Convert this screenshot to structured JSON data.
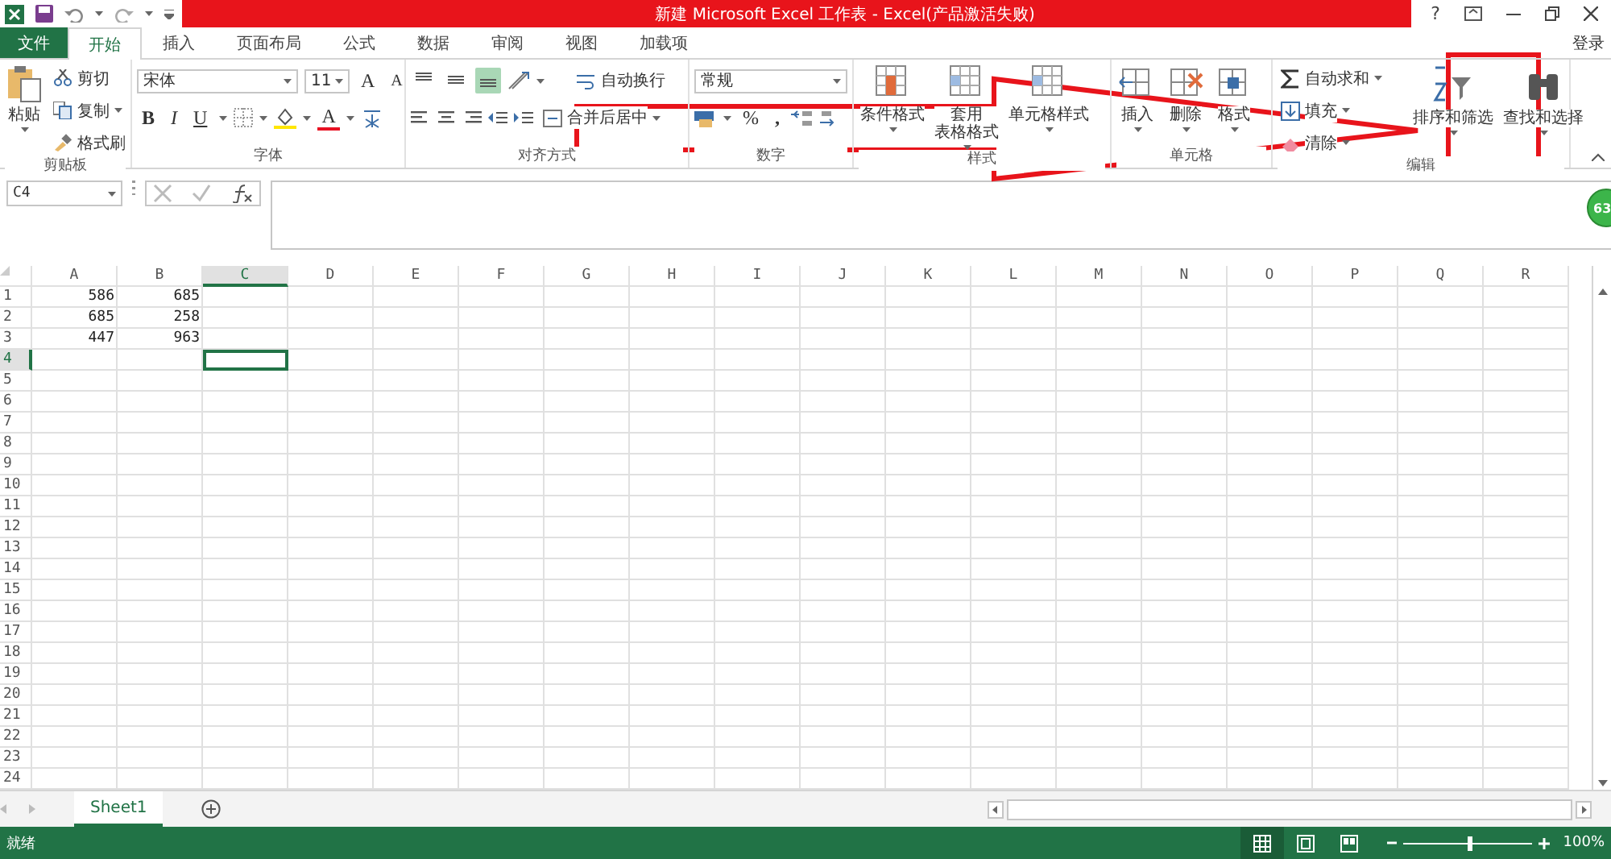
{
  "window": {
    "title": "新建 Microsoft Excel 工作表 - Excel(产品激活失败)",
    "help": "?"
  },
  "tabs": [
    {
      "label": "文件",
      "kind": "file",
      "selected": false
    },
    {
      "label": "开始",
      "kind": "tab",
      "selected": true
    },
    {
      "label": "插入",
      "kind": "tab",
      "selected": false
    },
    {
      "label": "页面布局",
      "kind": "tab",
      "selected": false
    },
    {
      "label": "公式",
      "kind": "tab",
      "selected": false
    },
    {
      "label": "数据",
      "kind": "tab",
      "selected": false
    },
    {
      "label": "审阅",
      "kind": "tab",
      "selected": false
    },
    {
      "label": "视图",
      "kind": "tab",
      "selected": false
    },
    {
      "label": "加载项",
      "kind": "tab",
      "selected": false
    }
  ],
  "sign_in": "登录",
  "ribbon": {
    "groups": [
      {
        "kind": "clipboard",
        "label": "剪贴板",
        "paste": "粘贴",
        "commands": [
          "剪切",
          "复制",
          "格式刷"
        ]
      },
      {
        "kind": "font",
        "label": "字体",
        "font": "宋体",
        "size": "11",
        "grow": "A",
        "shrink": "A",
        "bold": "B",
        "italic": "I",
        "underline": "U",
        "font_color": "A"
      },
      {
        "kind": "alignment",
        "label": "对齐方式",
        "wrap": "自动换行",
        "merge": "合并后居中",
        "vertical_align": [
          {
            "selected": false
          },
          {
            "selected": false
          },
          {
            "selected": true
          }
        ]
      },
      {
        "kind": "number",
        "label": "数字",
        "format": "常规",
        "percent": "%",
        "comma": ","
      },
      {
        "kind": "styles",
        "label": "样式",
        "buttons": [
          [
            "条件格式"
          ],
          [
            "套用",
            "表格格式"
          ],
          [
            "单元格样式"
          ]
        ]
      },
      {
        "kind": "cells",
        "label": "单元格",
        "buttons": [
          "插入",
          "删除",
          "格式"
        ]
      },
      {
        "kind": "editing",
        "label": "编辑",
        "commands": [
          "自动求和",
          "填充",
          "清除"
        ],
        "buttons": [
          "排序和筛选",
          "查找和选择"
        ]
      }
    ]
  },
  "formula_bar": {
    "name_box": "C4"
  },
  "badge": "63",
  "sheet": {
    "columns": [
      {
        "label": "A",
        "selected": false
      },
      {
        "label": "B",
        "selected": false
      },
      {
        "label": "C",
        "selected": true
      },
      {
        "label": "D",
        "selected": false
      },
      {
        "label": "E",
        "selected": false
      },
      {
        "label": "F",
        "selected": false
      },
      {
        "label": "G",
        "selected": false
      },
      {
        "label": "H",
        "selected": false
      },
      {
        "label": "I",
        "selected": false
      },
      {
        "label": "J",
        "selected": false
      },
      {
        "label": "K",
        "selected": false
      },
      {
        "label": "L",
        "selected": false
      },
      {
        "label": "M",
        "selected": false
      },
      {
        "label": "N",
        "selected": false
      },
      {
        "label": "O",
        "selected": false
      },
      {
        "label": "P",
        "selected": false
      },
      {
        "label": "Q",
        "selected": false
      },
      {
        "label": "R",
        "selected": false
      }
    ],
    "rows": [
      {
        "label": "1",
        "selected": false,
        "cells": [
          "586",
          "685"
        ]
      },
      {
        "label": "2",
        "selected": false,
        "cells": [
          "685",
          "258"
        ]
      },
      {
        "label": "3",
        "selected": false,
        "cells": [
          "447",
          "963"
        ]
      },
      {
        "label": "4",
        "selected": true,
        "cells": []
      },
      {
        "label": "5",
        "selected": false,
        "cells": []
      },
      {
        "label": "6",
        "selected": false,
        "cells": []
      },
      {
        "label": "7",
        "selected": false,
        "cells": []
      },
      {
        "label": "8",
        "selected": false,
        "cells": []
      },
      {
        "label": "9",
        "selected": false,
        "cells": []
      },
      {
        "label": "10",
        "selected": false,
        "cells": []
      },
      {
        "label": "11",
        "selected": false,
        "cells": []
      },
      {
        "label": "12",
        "selected": false,
        "cells": []
      },
      {
        "label": "13",
        "selected": false,
        "cells": []
      },
      {
        "label": "14",
        "selected": false,
        "cells": []
      },
      {
        "label": "15",
        "selected": false,
        "cells": []
      },
      {
        "label": "16",
        "selected": false,
        "cells": []
      },
      {
        "label": "17",
        "selected": false,
        "cells": []
      },
      {
        "label": "18",
        "selected": false,
        "cells": []
      },
      {
        "label": "19",
        "selected": false,
        "cells": []
      },
      {
        "label": "20",
        "selected": false,
        "cells": []
      },
      {
        "label": "21",
        "selected": false,
        "cells": []
      },
      {
        "label": "22",
        "selected": false,
        "cells": []
      },
      {
        "label": "23",
        "selected": false,
        "cells": []
      },
      {
        "label": "24",
        "selected": false,
        "cells": []
      }
    ]
  },
  "sheet_tabs": [
    {
      "label": "Sheet1",
      "selected": true
    }
  ],
  "status": {
    "text": "就绪",
    "views": [
      {
        "selected": true
      },
      {
        "selected": false
      },
      {
        "selected": false
      }
    ],
    "zoom_slider": {
      "level": 0.5
    },
    "zoom": "100%"
  }
}
